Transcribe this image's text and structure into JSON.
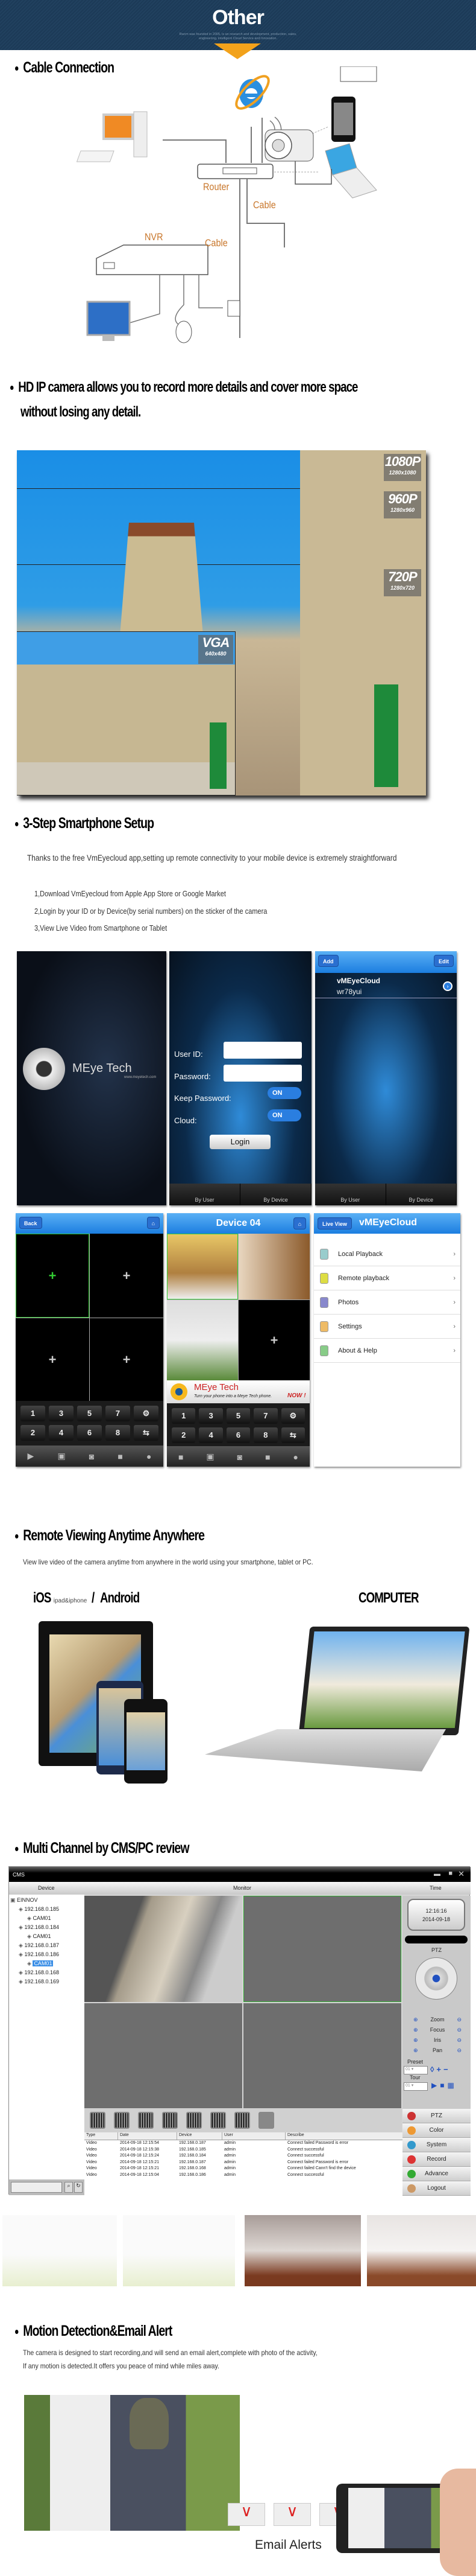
{
  "header": {
    "title": "Other",
    "subtitle": "Rwcm was founded in 2005, is an research and development, production, sales, engineering, intelligent Cloud Service and Innovation.",
    "accent": "#f2a21b",
    "bg": "#1c3a57"
  },
  "cable": {
    "heading": "Cable Connection",
    "labels": {
      "router": "Router",
      "cable1": "Cable",
      "nvr": "NVR",
      "cable2": "Cable"
    }
  },
  "hd": {
    "heading_line1": "HD IP camera allows you to record more details and cover more space",
    "heading_line2": "without losing any detail.",
    "resolutions": [
      {
        "name": "1080P",
        "size": "1280x1080"
      },
      {
        "name": "960P",
        "size": "1280x960"
      },
      {
        "name": "720P",
        "size": "1280x720"
      },
      {
        "name": "VGA",
        "size": "640x480"
      }
    ]
  },
  "setup": {
    "heading": "3-Step  Smartphone Setup",
    "intro": "Thanks to the free VmEyecloud app,setting up remote connectivity to your mobile device is extremely straightforward",
    "steps": [
      "1,Download VmEyecloud from Apple App Store or Google Market",
      "2,Login by your ID or by Device(by serial numbers) on the sticker of the camera",
      "3,View Live Video from Smartphone or Tablet"
    ],
    "splash": {
      "brand": "MEye Tech",
      "url": "www.meyetech.com"
    },
    "login": {
      "user_id": "User ID:",
      "password": "Password:",
      "keep": "Keep Password:",
      "cloud": "Cloud:",
      "on": "ON",
      "login": "Login",
      "tab_user": "By User",
      "tab_device": "By Device"
    },
    "devices": {
      "add": "Add",
      "edit": "Edit",
      "name": "vMEyeCloud",
      "id": "wr78yui",
      "tab_user": "By User",
      "tab_device": "By Device"
    },
    "live": {
      "back": "Back",
      "keys": [
        "1",
        "3",
        "5",
        "7",
        "⚙",
        "2",
        "4",
        "6",
        "8",
        "⇆"
      ]
    },
    "device4": {
      "title": "Device 04",
      "ad_brand": "MEye Tech",
      "ad_text": "Turn your phone into a Meye Tech phone.",
      "ad_now": "NOW !"
    },
    "menu": {
      "back": "Live View",
      "title": "vMEyeCloud",
      "items": [
        "Local Playback",
        "Remote playback",
        "Photos",
        "Settings",
        "About & Help"
      ]
    }
  },
  "remote": {
    "heading": "Remote Viewing Anytime Anywhere",
    "text": "View live video of the camera anytime from anywhere in the world using your smartphone, tablet or PC.",
    "ios": "iOS",
    "ios_sub": "ipad&iphone",
    "slash": "/",
    "android": "Android",
    "computer": "COMPUTER"
  },
  "cms": {
    "heading": "Multi Channel by CMS/PC review",
    "title": "CMS",
    "col_device": "Device",
    "col_monitor": "Monitor",
    "col_time": "Time",
    "tree": [
      {
        "label": "EINNOV",
        "level": 0
      },
      {
        "label": "192.168.0.185",
        "level": 1
      },
      {
        "label": "CAM01",
        "level": 2
      },
      {
        "label": "192.168.0.184",
        "level": 1
      },
      {
        "label": "CAM01",
        "level": 2
      },
      {
        "label": "192.168.0.187",
        "level": 1
      },
      {
        "label": "192.168.0.186",
        "level": 1
      },
      {
        "label": "CAM01",
        "level": 2,
        "selected": true
      },
      {
        "label": "192.168.0.168",
        "level": 1
      },
      {
        "label": "192.168.0.169",
        "level": 1
      }
    ],
    "time": "12:16:16",
    "date": "2014-09-18",
    "ptz": "PTZ",
    "controls": [
      "Zoom",
      "Focus",
      "Iris",
      "Pan"
    ],
    "preset": "Preset",
    "tour": "Tour",
    "preset_val": "01",
    "tour_val": "01",
    "menu": [
      "PTZ",
      "Color",
      "System",
      "Record",
      "Advance",
      "Logout"
    ],
    "log_headers": [
      "Type",
      "Date",
      "Device",
      "User",
      "Describe"
    ],
    "log": [
      [
        "Video",
        "2014-09-18 12:15:54",
        "192.168.0.187",
        "admin",
        "Connect failed Password is error"
      ],
      [
        "Video",
        "2014-09-18 12:15:38",
        "192.168.0.185",
        "admin",
        "Connect successful"
      ],
      [
        "Video",
        "2014-09-18 12:15:24",
        "192.168.0.184",
        "admin",
        "Connect successful"
      ],
      [
        "Video",
        "2014-09-18 12:15:21",
        "192.168.0.187",
        "admin",
        "Connect failed Password is error"
      ],
      [
        "Video",
        "2014-09-18 12:15:21",
        "192.168.0.168",
        "admin",
        "Connect failed Cann't find the device"
      ],
      [
        "Video",
        "2014-09-18 12:15:04",
        "192.168.0.186",
        "admin",
        "Connect successful"
      ]
    ]
  },
  "motion": {
    "heading": "Motion Detection&Email Alert",
    "line1": "The camera is designed to start recording,and will send an email alert,complete with photo of the activity,",
    "line2": "If any motion is detected.It offers you peace of mind while miles away.",
    "email": "Email Alerts"
  }
}
